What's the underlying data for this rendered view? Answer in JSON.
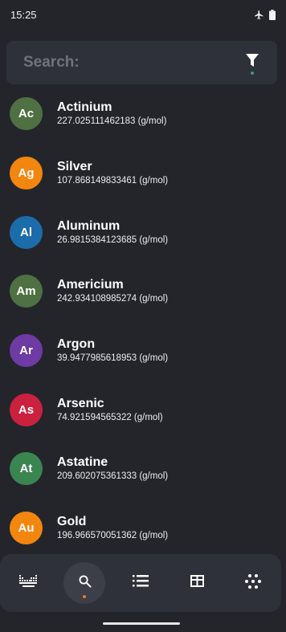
{
  "status": {
    "time": "15:25"
  },
  "search": {
    "placeholder": "Search:",
    "value": ""
  },
  "elements": [
    {
      "symbol": "Ac",
      "name": "Actinium",
      "mass": "227.025111462183 (g/mol)",
      "color": "#4e7042"
    },
    {
      "symbol": "Ag",
      "name": "Silver",
      "mass": "107.868149833461 (g/mol)",
      "color": "#f2860e"
    },
    {
      "symbol": "Al",
      "name": "Aluminum",
      "mass": "26.9815384123685 (g/mol)",
      "color": "#1b6cab"
    },
    {
      "symbol": "Am",
      "name": "Americium",
      "mass": "242.934108985274 (g/mol)",
      "color": "#4e7042"
    },
    {
      "symbol": "Ar",
      "name": "Argon",
      "mass": "39.9477985618953 (g/mol)",
      "color": "#6e3aa3"
    },
    {
      "symbol": "As",
      "name": "Arsenic",
      "mass": "74.921594565322 (g/mol)",
      "color": "#c9213e"
    },
    {
      "symbol": "At",
      "name": "Astatine",
      "mass": "209.602075361333 (g/mol)",
      "color": "#3b8550"
    },
    {
      "symbol": "Au",
      "name": "Gold",
      "mass": "196.966570051362 (g/mol)",
      "color": "#f2860e"
    }
  ],
  "nav": {
    "items": [
      {
        "icon": "periodic-chart-icon",
        "active": false
      },
      {
        "icon": "search-icon",
        "active": true
      },
      {
        "icon": "list-icon",
        "active": false
      },
      {
        "icon": "table-icon",
        "active": false
      },
      {
        "icon": "dots-grid-icon",
        "active": false
      }
    ]
  },
  "colors": {
    "background": "#23252b",
    "surface": "#2e3139",
    "accent_orange": "#e87a2c",
    "accent_green": "#3ea06a"
  }
}
